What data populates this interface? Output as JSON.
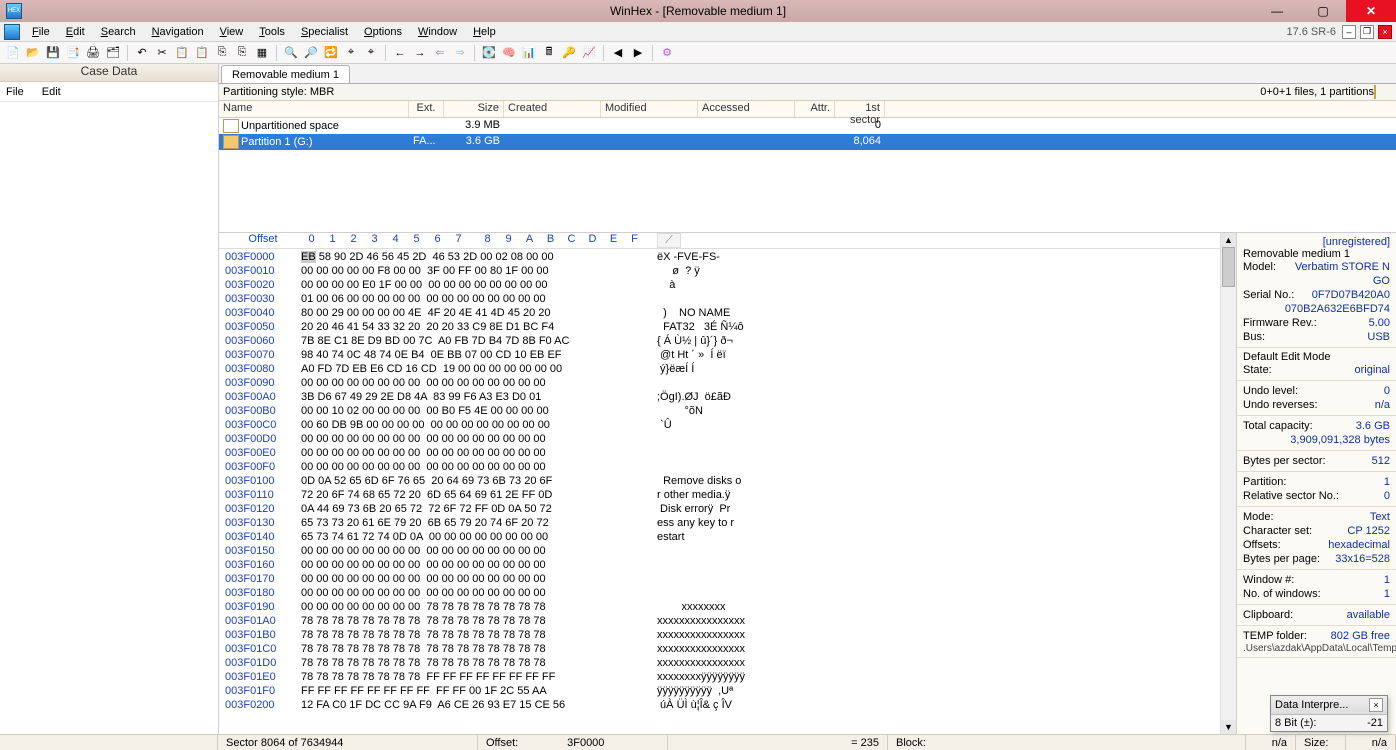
{
  "window": {
    "title": "WinHex - [Removable medium 1]",
    "version": "17.6 SR-6"
  },
  "menu": [
    "File",
    "Edit",
    "Search",
    "Navigation",
    "View",
    "Tools",
    "Specialist",
    "Options",
    "Window",
    "Help"
  ],
  "case": {
    "title": "Case Data",
    "menu": [
      "File",
      "Edit"
    ]
  },
  "tab": {
    "label": "Removable medium 1"
  },
  "part_style_label": "Partitioning style: MBR",
  "files_summary": "0+0+1 files, 1 partitions",
  "list": {
    "headers": [
      "Name",
      "Ext.",
      "Size",
      "Created",
      "Modified",
      "Accessed",
      "Attr.",
      "1st sector"
    ],
    "rows": [
      {
        "name": "Unpartitioned space",
        "ext": "",
        "size": "3.9 MB",
        "created": "",
        "mod": "",
        "acc": "",
        "attr": "",
        "fs": "0",
        "sel": false,
        "icon": "doc"
      },
      {
        "name": "Partition 1 (G:)",
        "ext": "FA...",
        "size": "3.6 GB",
        "created": "",
        "mod": "",
        "acc": "",
        "attr": "",
        "fs": "8,064",
        "sel": true,
        "icon": "drive"
      }
    ]
  },
  "hex": {
    "header": {
      "offset": "Offset",
      "cols": [
        "0",
        "1",
        "2",
        "3",
        "4",
        "5",
        "6",
        "7",
        "8",
        "9",
        "A",
        "B",
        "C",
        "D",
        "E",
        "F"
      ]
    },
    "rows": [
      {
        "o": "003F0000",
        "b": "EB 58 90 2D 46 56 45 2D  46 53 2D 00 02 08 00 00",
        "a": "ëX -FVE-FS-     "
      },
      {
        "o": "003F0010",
        "b": "00 00 00 00 00 F8 00 00  3F 00 FF 00 80 1F 00 00",
        "a": "     ø  ? ÿ     "
      },
      {
        "o": "003F0020",
        "b": "00 00 00 00 E0 1F 00 00  00 00 00 00 00 00 00 00",
        "a": "    à           "
      },
      {
        "o": "003F0030",
        "b": "01 00 06 00 00 00 00 00  00 00 00 00 00 00 00 00",
        "a": "                "
      },
      {
        "o": "003F0040",
        "b": "80 00 29 00 00 00 00 4E  4F 20 4E 41 4D 45 20 20",
        "a": "  )    NO NAME  "
      },
      {
        "o": "003F0050",
        "b": "20 20 46 41 54 33 32 20  20 20 33 C9 8E D1 BC F4",
        "a": "  FAT32   3É Ñ¼ô"
      },
      {
        "o": "003F0060",
        "b": "7B 8E C1 8E D9 BD 00 7C  A0 FB 7D B4 7D 8B F0 AC",
        "a": "{ Á Ù½ | û}´} ð¬"
      },
      {
        "o": "003F0070",
        "b": "98 40 74 0C 48 74 0E B4  0E BB 07 00 CD 10 EB EF",
        "a": " @t Ht ´ »  Í ëï"
      },
      {
        "o": "003F0080",
        "b": "A0 FD 7D EB E6 CD 16 CD  19 00 00 00 00 00 00 00",
        "a": " ý}ëæÍ Í        "
      },
      {
        "o": "003F0090",
        "b": "00 00 00 00 00 00 00 00  00 00 00 00 00 00 00 00",
        "a": "                "
      },
      {
        "o": "003F00A0",
        "b": "3B D6 67 49 29 2E D8 4A  83 99 F6 A3 E3 D0 01     ",
        "a": ";ÖgI).ØJ  ö£ãÐ  "
      },
      {
        "o": "003F00B0",
        "b": "00 00 10 02 00 00 00 00  00 B0 F5 4E 00 00 00 00",
        "a": "         °õN    "
      },
      {
        "o": "003F00C0",
        "b": "00 60 DB 9B 00 00 00 00  00 00 00 00 00 00 00 00",
        "a": " `Û             "
      },
      {
        "o": "003F00D0",
        "b": "00 00 00 00 00 00 00 00  00 00 00 00 00 00 00 00",
        "a": "                "
      },
      {
        "o": "003F00E0",
        "b": "00 00 00 00 00 00 00 00  00 00 00 00 00 00 00 00",
        "a": "                "
      },
      {
        "o": "003F00F0",
        "b": "00 00 00 00 00 00 00 00  00 00 00 00 00 00 00 00",
        "a": "                "
      },
      {
        "o": "003F0100",
        "b": "0D 0A 52 65 6D 6F 76 65  20 64 69 73 6B 73 20 6F",
        "a": "  Remove disks o"
      },
      {
        "o": "003F0110",
        "b": "72 20 6F 74 68 65 72 20  6D 65 64 69 61 2E FF 0D",
        "a": "r other media.ÿ "
      },
      {
        "o": "003F0120",
        "b": "0A 44 69 73 6B 20 65 72  72 6F 72 FF 0D 0A 50 72",
        "a": " Disk errorÿ  Pr"
      },
      {
        "o": "003F0130",
        "b": "65 73 73 20 61 6E 79 20  6B 65 79 20 74 6F 20 72",
        "a": "ess any key to r"
      },
      {
        "o": "003F0140",
        "b": "65 73 74 61 72 74 0D 0A  00 00 00 00 00 00 00 00",
        "a": "estart          "
      },
      {
        "o": "003F0150",
        "b": "00 00 00 00 00 00 00 00  00 00 00 00 00 00 00 00",
        "a": "                "
      },
      {
        "o": "003F0160",
        "b": "00 00 00 00 00 00 00 00  00 00 00 00 00 00 00 00",
        "a": "                "
      },
      {
        "o": "003F0170",
        "b": "00 00 00 00 00 00 00 00  00 00 00 00 00 00 00 00",
        "a": "                "
      },
      {
        "o": "003F0180",
        "b": "00 00 00 00 00 00 00 00  00 00 00 00 00 00 00 00",
        "a": "                "
      },
      {
        "o": "003F0190",
        "b": "00 00 00 00 00 00 00 00  78 78 78 78 78 78 78 78",
        "a": "        xxxxxxxx"
      },
      {
        "o": "003F01A0",
        "b": "78 78 78 78 78 78 78 78  78 78 78 78 78 78 78 78",
        "a": "xxxxxxxxxxxxxxxx"
      },
      {
        "o": "003F01B0",
        "b": "78 78 78 78 78 78 78 78  78 78 78 78 78 78 78 78",
        "a": "xxxxxxxxxxxxxxxx"
      },
      {
        "o": "003F01C0",
        "b": "78 78 78 78 78 78 78 78  78 78 78 78 78 78 78 78",
        "a": "xxxxxxxxxxxxxxxx"
      },
      {
        "o": "003F01D0",
        "b": "78 78 78 78 78 78 78 78  78 78 78 78 78 78 78 78",
        "a": "xxxxxxxxxxxxxxxx"
      },
      {
        "o": "003F01E0",
        "b": "78 78 78 78 78 78 78 78  FF FF FF FF FF FF FF FF",
        "a": "xxxxxxxxÿÿÿÿÿÿÿÿ"
      },
      {
        "o": "003F01F0",
        "b": "FF FF FF FF FF FF FF FF  FF FF 00 1F 2C 55 AA   ",
        "a": "ÿÿÿÿÿÿÿÿÿÿ  ,Uª "
      },
      {
        "o": "003F0200",
        "b": "12 FA C0 1F DC CC 9A F9  A6 CE 26 93 E7 15 CE 56",
        "a": " úÀ ÜÌ ù¦Î& ç ÎV"
      }
    ]
  },
  "info": {
    "unreg": "[unregistered]",
    "medium": "Removable medium 1",
    "model_l": "Model:",
    "model": "Verbatim STORE N GO",
    "serial_l": "Serial No.:",
    "serial": "0F7D07B420A0",
    "serial2": "070B2A632E6BFD74",
    "fw_l": "Firmware Rev.:",
    "fw": "5.00",
    "bus_l": "Bus:",
    "bus": "USB",
    "mode_hdr": "Default Edit Mode",
    "state_l": "State:",
    "state": "original",
    "undo_l": "Undo level:",
    "undo": "0",
    "undor_l": "Undo reverses:",
    "undor": "n/a",
    "cap_l": "Total capacity:",
    "cap": "3.6 GB",
    "cap2": "3,909,091,328 bytes",
    "bps_l": "Bytes per sector:",
    "bps": "512",
    "part_l": "Partition:",
    "part": "1",
    "rsn_l": "Relative sector No.:",
    "rsn": "0",
    "mode_l": "Mode:",
    "mode": "Text",
    "cs_l": "Character set:",
    "cs": "CP 1252",
    "ofs_l": "Offsets:",
    "ofs": "hexadecimal",
    "bpp_l": "Bytes per page:",
    "bpp": "33x16=528",
    "win_l": "Window #:",
    "win": "1",
    "nwin_l": "No. of windows:",
    "nwin": "1",
    "clip_l": "Clipboard:",
    "clip": "available",
    "tmp_l": "TEMP folder:",
    "tmp": "802 GB free",
    "tmp2": ".Users\\azdak\\AppData\\Local\\Temp"
  },
  "status": {
    "sector": "Sector 8064 of 7634944",
    "offset_l": "Offset:",
    "offset": "3F0000",
    "eq": "= 235",
    "block_l": "Block:",
    "block": "n/a",
    "size_l": "Size:",
    "size": "n/a"
  },
  "interp": {
    "title": "Data Interpre...",
    "row_l": "8 Bit (±):",
    "row_v": "-21"
  }
}
